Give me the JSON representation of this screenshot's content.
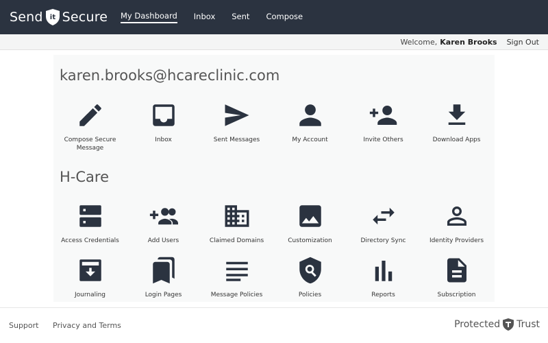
{
  "header": {
    "logo_left": "Send",
    "logo_mid": "it",
    "logo_right": "Secure",
    "nav": [
      {
        "label": "My Dashboard",
        "active": true
      },
      {
        "label": "Inbox"
      },
      {
        "label": "Sent"
      },
      {
        "label": "Compose"
      }
    ]
  },
  "userbar": {
    "welcome": "Welcome,",
    "user_name": "Karen Brooks",
    "sign_out": "Sign Out"
  },
  "account_section": {
    "title": "karen.brooks@hcareclinic.com",
    "tiles": [
      {
        "label": "Compose Secure Message",
        "icon": "pencil-icon"
      },
      {
        "label": "Inbox",
        "icon": "inbox-icon"
      },
      {
        "label": "Sent Messages",
        "icon": "send-icon"
      },
      {
        "label": "My Account",
        "icon": "person-icon"
      },
      {
        "label": "Invite Others",
        "icon": "add-person-icon"
      },
      {
        "label": "Download Apps",
        "icon": "download-icon"
      }
    ]
  },
  "org_section": {
    "title": "H-Care",
    "tiles_row1": [
      {
        "label": "Access Credentials",
        "icon": "server-icon"
      },
      {
        "label": "Add Users",
        "icon": "add-group-icon"
      },
      {
        "label": "Claimed Domains",
        "icon": "building-icon"
      },
      {
        "label": "Customization",
        "icon": "image-icon"
      },
      {
        "label": "Directory Sync",
        "icon": "sync-arrows-icon"
      },
      {
        "label": "Identity Providers",
        "icon": "person-outline-icon"
      }
    ],
    "tiles_row2": [
      {
        "label": "Journaling",
        "icon": "archive-icon"
      },
      {
        "label": "Login Pages",
        "icon": "bookmarks-icon"
      },
      {
        "label": "Message Policies",
        "icon": "lines-icon"
      },
      {
        "label": "Policies",
        "icon": "shield-search-icon"
      },
      {
        "label": "Reports",
        "icon": "bar-chart-icon"
      },
      {
        "label": "Subscription",
        "icon": "document-icon"
      }
    ]
  },
  "footer": {
    "support": "Support",
    "privacy": "Privacy and Terms",
    "brand_left": "Protected",
    "brand_right": "Trust"
  },
  "colors": {
    "nav_bg": "#2b3340",
    "icon": "#2b3340",
    "panel_bg": "#f8f9f9"
  }
}
